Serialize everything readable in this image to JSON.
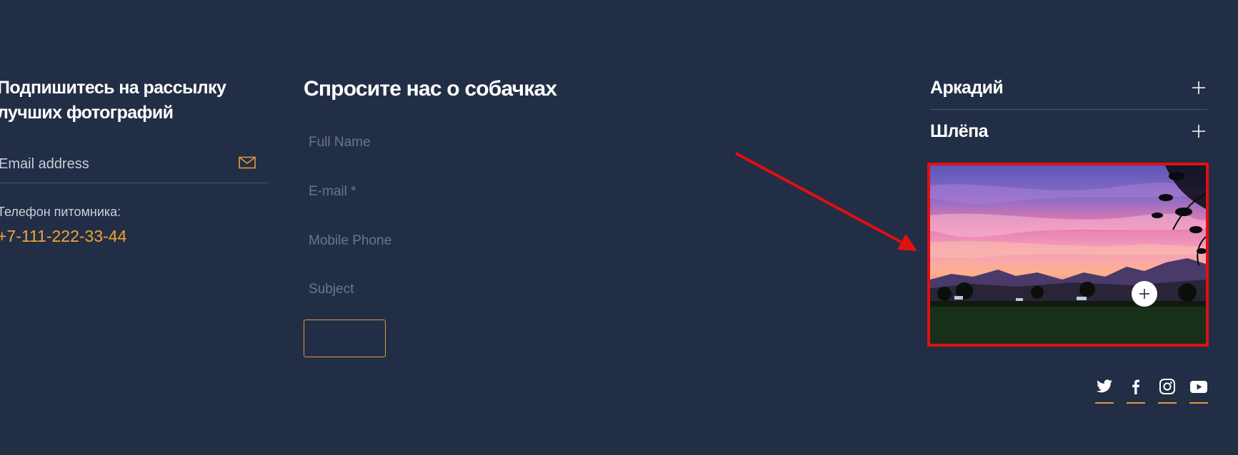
{
  "newsletter": {
    "title": "Подпишитесь на рассылку\nлучших фотографий",
    "email_placeholder": "Email address",
    "icon": "mail-icon",
    "phone_label": "Телефон питомника:",
    "phone_number": "+7-111-222-33-44"
  },
  "contact": {
    "title": "Спросите нас о собачках",
    "fields": {
      "full_name": "Full Name",
      "email": "E-mail *",
      "mobile": "Mobile Phone",
      "subject": "Subject"
    },
    "submit_label": ""
  },
  "accordion": {
    "items": [
      {
        "label": "Аркадий",
        "icon": "plus-icon"
      },
      {
        "label": "Шлёпа",
        "icon": "plus-icon"
      }
    ]
  },
  "gallery": {
    "image": "sunset-mountains-photo",
    "zoom_icon": "plus-icon",
    "highlight_color": "#e01010"
  },
  "social": [
    "twitter-icon",
    "facebook-icon",
    "instagram-icon",
    "youtube-icon"
  ],
  "colors": {
    "background": "#222e45",
    "accent": "#f0a531",
    "annotation": "#e01010"
  }
}
